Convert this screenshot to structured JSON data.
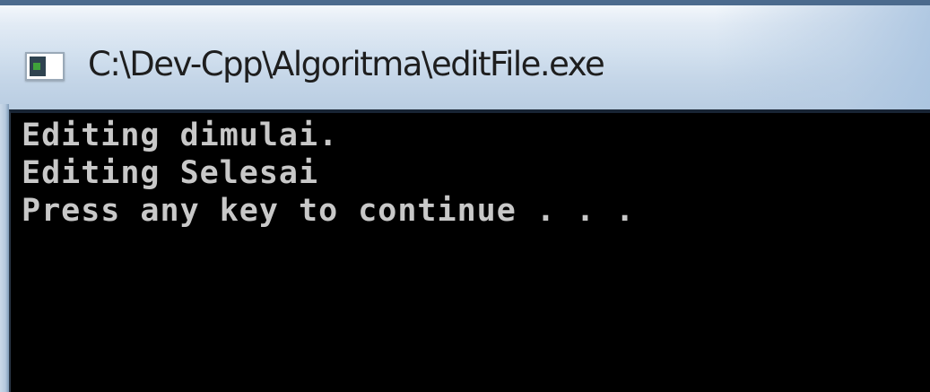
{
  "window": {
    "title": "C:\\Dev-Cpp\\Algoritma\\editFile.exe",
    "icon": "console-app-icon"
  },
  "console": {
    "lines": [
      "Editing dimulai.",
      "Editing Selesai",
      "Press any key to continue . . ."
    ],
    "background_color": "#000000",
    "text_color": "#c8c8c8"
  },
  "colors": {
    "title_bar": "#d3e1ef",
    "frame": "#4b6a8d"
  }
}
